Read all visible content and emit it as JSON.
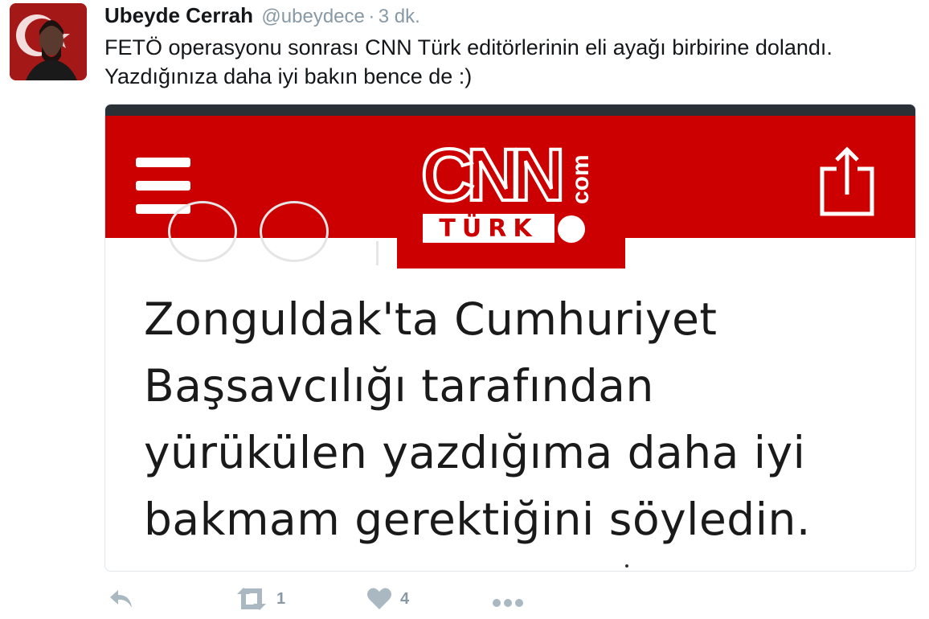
{
  "tweet": {
    "author_name": "Ubeyde Cerrah",
    "handle": "@ubeydece",
    "separator": "·",
    "time": "3 dk.",
    "text_lines": [
      "FETÖ operasyonu sonrası CNN Türk editörlerinin eli ayağı birbirine dolandı.",
      "Yazdığınıza daha iyi bakın bence de :)"
    ]
  },
  "media": {
    "logo": {
      "main": "CNN",
      "suffix": "com",
      "sub": "TÜRK"
    },
    "headline_lines": [
      "Zonguldak'ta Cumhuriyet",
      "Başsavcılığı tarafından",
      "yürükülen yazdığıma daha iyi",
      "bakmam gerektiğini söyledin."
    ],
    "icons": {
      "menu": "hamburger-menu-icon",
      "share": "share-icon"
    },
    "colors": {
      "header": "#cc0000",
      "top_strip": "#2b2f36"
    }
  },
  "actions": {
    "reply": {
      "icon": "reply-icon"
    },
    "retweet": {
      "icon": "retweet-icon",
      "count": "1"
    },
    "like": {
      "icon": "heart-icon",
      "count": "4"
    },
    "more": {
      "icon": "more-icon"
    }
  }
}
